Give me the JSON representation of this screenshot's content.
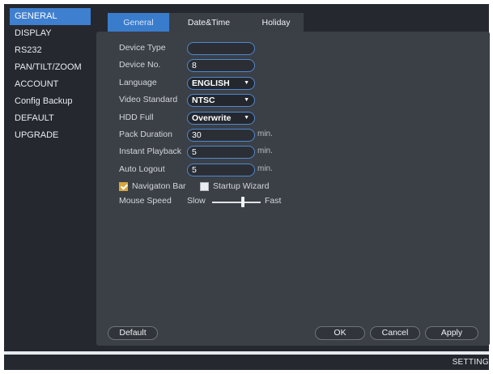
{
  "sidebar": {
    "items": [
      {
        "label": "GENERAL",
        "active": true
      },
      {
        "label": "DISPLAY"
      },
      {
        "label": "RS232"
      },
      {
        "label": "PAN/TILT/ZOOM"
      },
      {
        "label": "ACCOUNT"
      },
      {
        "label": "Config Backup"
      },
      {
        "label": "DEFAULT"
      },
      {
        "label": "UPGRADE"
      }
    ]
  },
  "tabs": [
    {
      "label": "General",
      "active": true
    },
    {
      "label": "Date&Time"
    },
    {
      "label": "Holiday"
    }
  ],
  "form": {
    "device_type": {
      "label": "Device Type",
      "value": ""
    },
    "device_no": {
      "label": "Device No.",
      "value": "8"
    },
    "language": {
      "label": "Language",
      "value": "ENGLISH"
    },
    "video_standard": {
      "label": "Video Standard",
      "value": "NTSC"
    },
    "hdd_full": {
      "label": "HDD Full",
      "value": "Overwrite"
    },
    "pack_duration": {
      "label": "Pack Duration",
      "value": "30",
      "unit": "min."
    },
    "instant_playback": {
      "label": "Instant Playback",
      "value": "5",
      "unit": "min."
    },
    "auto_logout": {
      "label": "Auto Logout",
      "value": "5",
      "unit": "min."
    },
    "navigation_bar": {
      "label": "Navigaton Bar",
      "checked": true
    },
    "startup_wizard": {
      "label": "Startup Wizard",
      "checked": false
    },
    "mouse_speed": {
      "label": "Mouse Speed",
      "min_label": "Slow",
      "max_label": "Fast",
      "level": 0.65
    }
  },
  "buttons": {
    "default": "Default",
    "ok": "OK",
    "cancel": "Cancel",
    "apply": "Apply"
  },
  "footer": {
    "label": "SETTING"
  },
  "colors": {
    "accent": "#3a7ccc",
    "panel": "#3b3f46",
    "background": "#25292f",
    "checkbox": "#d7a63b"
  }
}
